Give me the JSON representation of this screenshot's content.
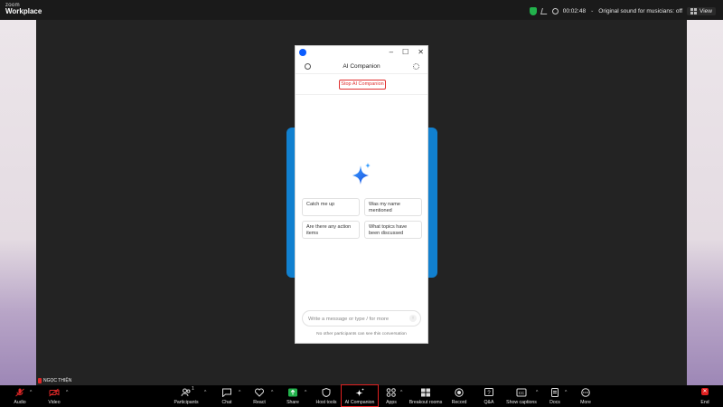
{
  "brand": {
    "line1": "zoom",
    "line2": "Workplace"
  },
  "topbar": {
    "timer": "00:02:48",
    "sound": "Original sound for musicians: off",
    "view": "View"
  },
  "companion": {
    "title": "AI Companion",
    "stop_label": "Stop AI Companion",
    "chips": [
      "Catch me up",
      "Was my name mentioned",
      "Are there any action items",
      "What topics have been discussed"
    ],
    "input_placeholder": "Write a message or type / for more",
    "notice": "No other participants can see this conversation",
    "window_controls": [
      "–",
      "☐",
      "✕"
    ]
  },
  "participant_name": "NGỌC THIỆN",
  "toolbar": {
    "participants_count": "1",
    "items": [
      "Audio",
      "Video",
      "Participants",
      "Chat",
      "React",
      "Share",
      "Host tools",
      "AI Companion",
      "Apps",
      "Breakout rooms",
      "Record",
      "Q&A",
      "Show captions",
      "Docs",
      "More",
      "End"
    ]
  },
  "colors": {
    "accent": "#0b5cff",
    "stop": "#e03131",
    "blue_card": "#1180cf",
    "end": "#e02020",
    "security_shield": "#22b24c"
  },
  "icons": [
    "security-shield-icon",
    "clock-icon",
    "music-icon",
    "grid-icon",
    "history-icon",
    "settings-icon",
    "sparkle-icon",
    "send-icon",
    "mic-muted-icon",
    "video-off-icon",
    "participants-icon",
    "chat-icon",
    "heart-icon",
    "share-icon",
    "shield-icon",
    "ai-sparkle-icon",
    "apps-icon",
    "breakout-icon",
    "record-icon",
    "qa-icon",
    "cc-icon",
    "docs-icon",
    "more-icon",
    "end-icon"
  ]
}
